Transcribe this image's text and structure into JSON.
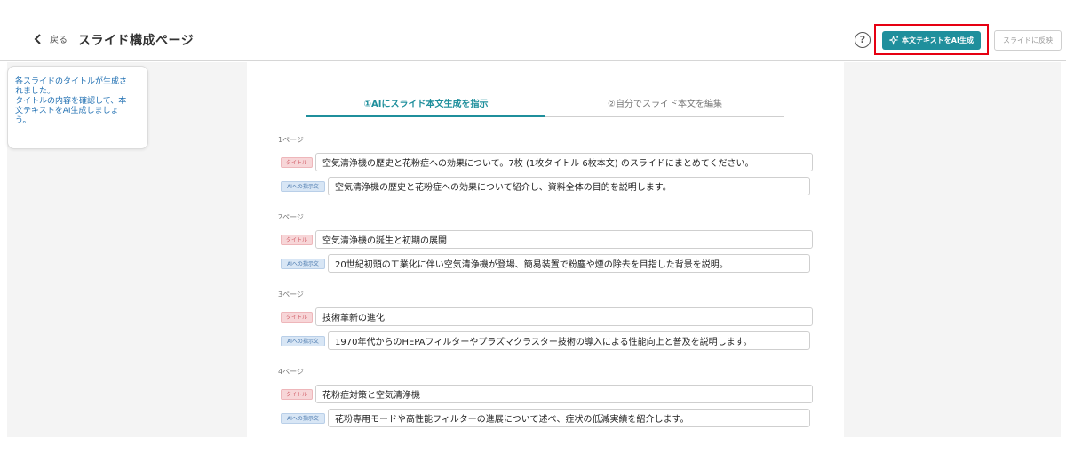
{
  "header": {
    "back_label": "戻る",
    "page_title": "スライド構成ページ",
    "help_symbol": "?",
    "ai_generate_label": "本文テキストをAI生成",
    "reflect_label": "スライドに反映"
  },
  "tip": {
    "line1": "各スライドのタイトルが生成さ",
    "line2": "れました。",
    "line3": "タイトルの内容を確認して、本",
    "line4": "文テキストをAI生成しましょ",
    "line5": "う。"
  },
  "tabs": [
    {
      "label": "①AIにスライド本文生成を指示",
      "active": true
    },
    {
      "label": "②自分でスライド本文を編集",
      "active": false
    }
  ],
  "tags": {
    "title": "タイトル",
    "ai": "AIへの指示文"
  },
  "sections": [
    {
      "label": "1ページ",
      "title": "空気清浄機の歴史と花粉症への効果について。7枚 (1枚タイトル 6枚本文) のスライドにまとめてください。",
      "instruction": "空気清浄機の歴史と花粉症への効果について紹介し、資料全体の目的を説明します。"
    },
    {
      "label": "2ページ",
      "title": "空気清浄機の誕生と初期の展開",
      "instruction": "20世紀初頭の工業化に伴い空気清浄機が登場、簡易装置で粉塵や煙の除去を目指した背景を説明。"
    },
    {
      "label": "3ページ",
      "title": "技術革新の進化",
      "instruction": "1970年代からのHEPAフィルターやプラズマクラスター技術の導入による性能向上と普及を説明します。"
    },
    {
      "label": "4ページ",
      "title": "花粉症対策と空気清浄機",
      "instruction": "花粉専用モードや高性能フィルターの進展について述べ、症状の低減実績を紹介します。"
    }
  ],
  "colors": {
    "accent": "#1f8f9c",
    "highlight": "#e60012",
    "tip_text": "#1f6fb2",
    "title_tag_bg": "#f7d6d8",
    "ai_tag_bg": "#d8e6f5"
  }
}
